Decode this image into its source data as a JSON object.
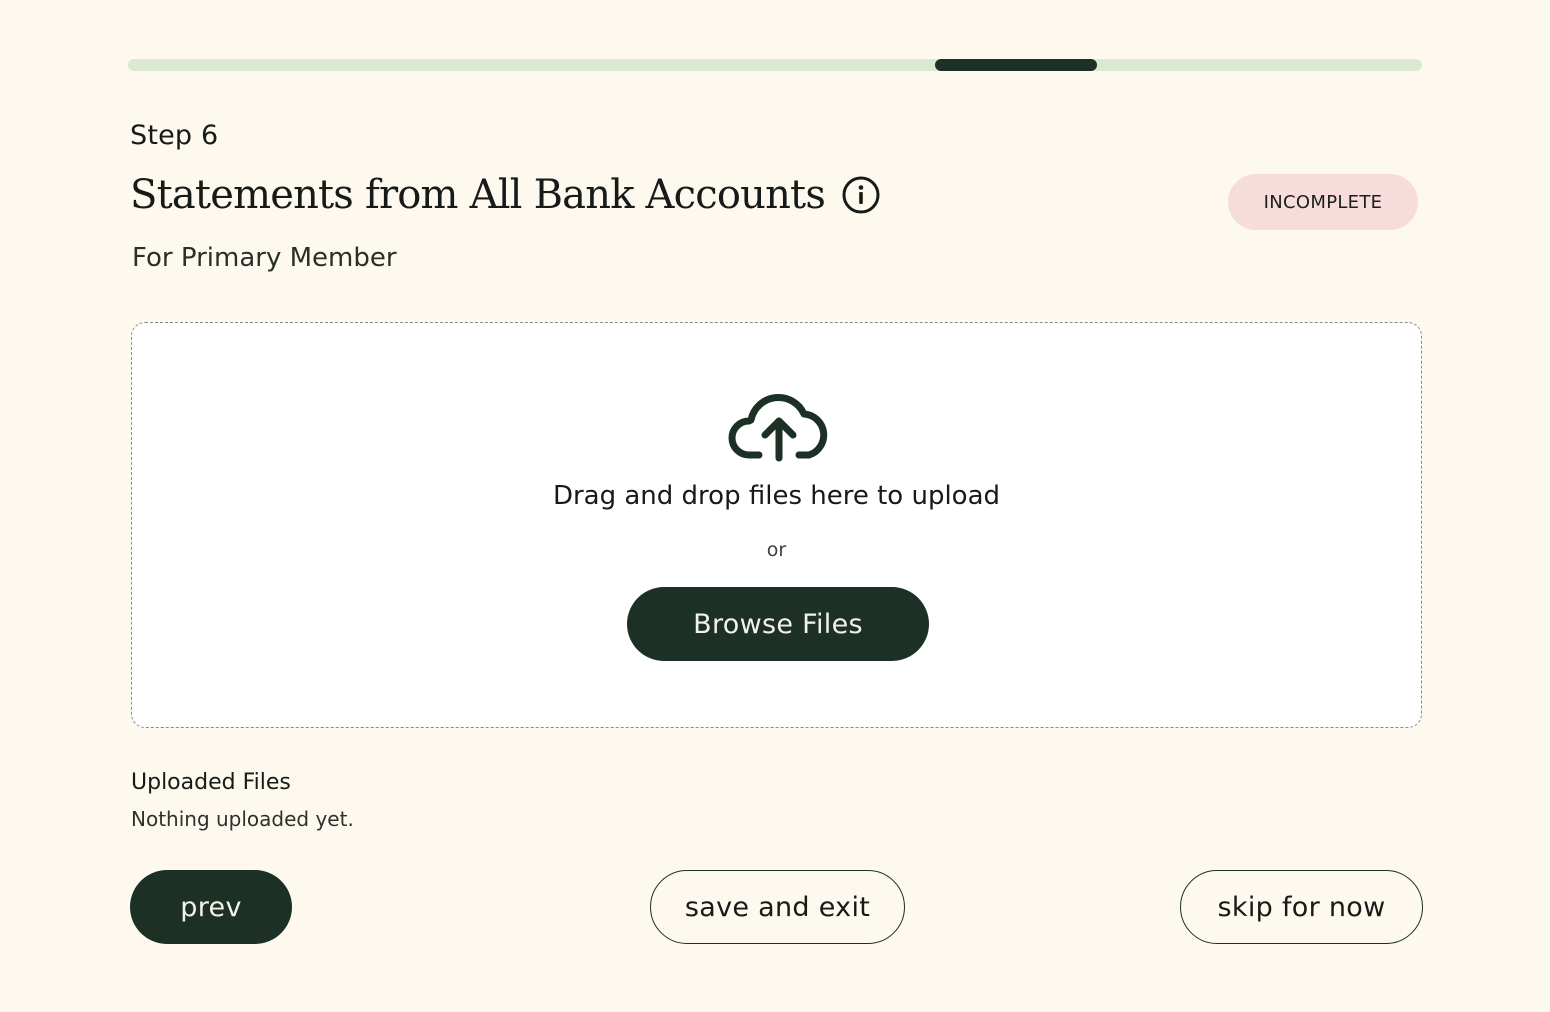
{
  "progress": {
    "current_step": 6,
    "fraction_start": 0.624,
    "fraction_end": 0.749
  },
  "header": {
    "step_label": "Step 6",
    "title": "Statements from All Bank Accounts",
    "status": "INCOMPLETE",
    "subtitle": "For Primary Member"
  },
  "dropzone": {
    "title": "Drag and drop files here to upload",
    "or_text": "or",
    "browse_label": "Browse Files"
  },
  "uploaded": {
    "heading": "Uploaded Files",
    "empty_text": "Nothing uploaded yet."
  },
  "footer": {
    "prev_label": "prev",
    "save_label": "save and exit",
    "skip_label": "skip for now"
  },
  "icons": {
    "info": "info-circle-icon",
    "upload": "cloud-upload-icon"
  },
  "colors": {
    "background": "#fdf9ee",
    "primary_dark": "#1c3026",
    "progress_track": "#dbe8d2",
    "badge_incomplete": "#f7dcdc"
  }
}
